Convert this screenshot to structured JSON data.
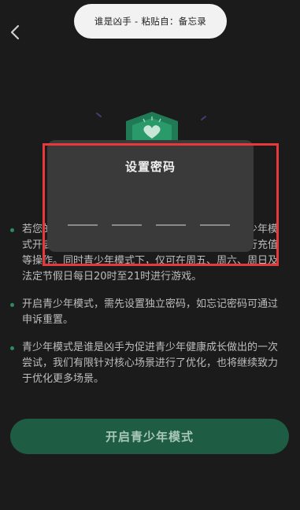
{
  "toast": {
    "text": "谁是凶手 - 粘贴自：备忘录"
  },
  "icons": {
    "back": "chevron-left-icon",
    "badge": "shield-heart-icon"
  },
  "bullets": [
    "若您的孩子想玩游戏，请点击开启青少年模式，青少年模式开启后，用户只能使用游戏基础功能，且无法进行充值等操作。同时青少年模式下，仅可在周五、周六、周日及法定节假日每日20时至21时进行游戏。",
    "开启青少年模式，需先设置独立密码，如忘记密码可通过申诉重置。",
    "青少年模式是谁是凶手为促进青少年健康成长做出的一次尝试，我们有限针对核心场景进行了优化，也将继续致力于优化更多场景。"
  ],
  "cta": {
    "label": "开启青少年模式"
  },
  "dialog": {
    "title": "设置密码"
  },
  "colors": {
    "accent": "#2f8a5e",
    "highlight": "#e8383b",
    "cta_bg": "#1f5c44"
  }
}
